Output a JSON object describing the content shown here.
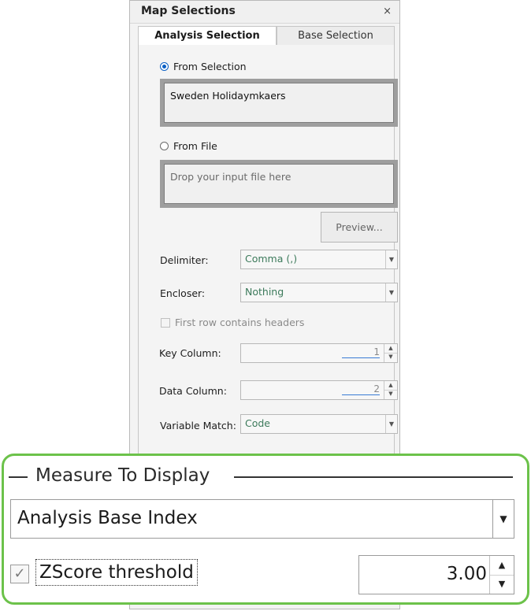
{
  "window": {
    "title": "Map Selections",
    "close_glyph": "×"
  },
  "tabs": [
    {
      "label": "Analysis Selection",
      "active": true
    },
    {
      "label": "Base Selection",
      "active": false
    }
  ],
  "source": {
    "from_selection_label": "From Selection",
    "selection_value": "Sweden Holidaymkaers",
    "from_file_label": "From File",
    "drop_placeholder": "Drop your input file here",
    "preview_label": "Preview..."
  },
  "fields": {
    "delimiter_label": "Delimiter:",
    "delimiter_value": "Comma (,)",
    "encloser_label": "Encloser:",
    "encloser_value": "Nothing",
    "headers_label": "First row contains headers",
    "key_column_label": "Key Column:",
    "key_column_value": "1",
    "data_column_label": "Data Column:",
    "data_column_value": "2",
    "variable_match_label": "Variable Match:",
    "variable_match_value": "Code"
  },
  "measure": {
    "legend": "Measure To Display",
    "selected": "Analysis Base Index",
    "zscore_label": "ZScore threshold",
    "zscore_checked": true,
    "zscore_value": "3.00"
  },
  "colors": {
    "highlight": "#6cc24a",
    "radio_accent": "#0a5fc4"
  }
}
